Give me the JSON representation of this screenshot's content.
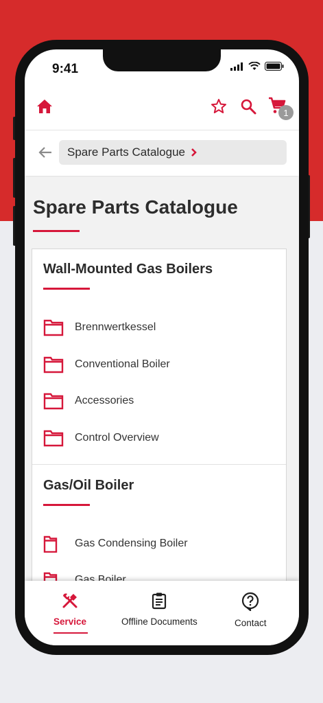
{
  "colors": {
    "brand_red": "#d6173a",
    "background_red": "#d62b2b",
    "badge_grey": "#9a9a9a"
  },
  "status_bar": {
    "time": "9:41"
  },
  "header": {
    "home_icon": "home-icon",
    "favorites_icon": "star-outline-icon",
    "search_icon": "search-icon",
    "cart_icon": "cart-icon",
    "cart_count": "1"
  },
  "breadcrumb": {
    "back_icon": "arrow-left-icon",
    "label": "Spare Parts Catalogue",
    "chevron_icon": "chevron-right-icon"
  },
  "page": {
    "title": "Spare Parts Catalogue"
  },
  "sections": [
    {
      "title": "Wall-Mounted Gas Boilers",
      "items": [
        "Brennwertkessel",
        "Conventional Boiler",
        "Accessories",
        "Control Overview"
      ]
    },
    {
      "title": "Gas/Oil Boiler",
      "items": [
        "Gas Condensing Boiler",
        "Gas Boiler"
      ]
    }
  ],
  "tabbar": {
    "tabs": [
      {
        "label": "Service",
        "icon": "tools-icon",
        "active": true
      },
      {
        "label": "Offline Documents",
        "icon": "clipboard-icon",
        "active": false
      },
      {
        "label": "Contact",
        "icon": "help-bubble-icon",
        "active": false
      }
    ]
  }
}
